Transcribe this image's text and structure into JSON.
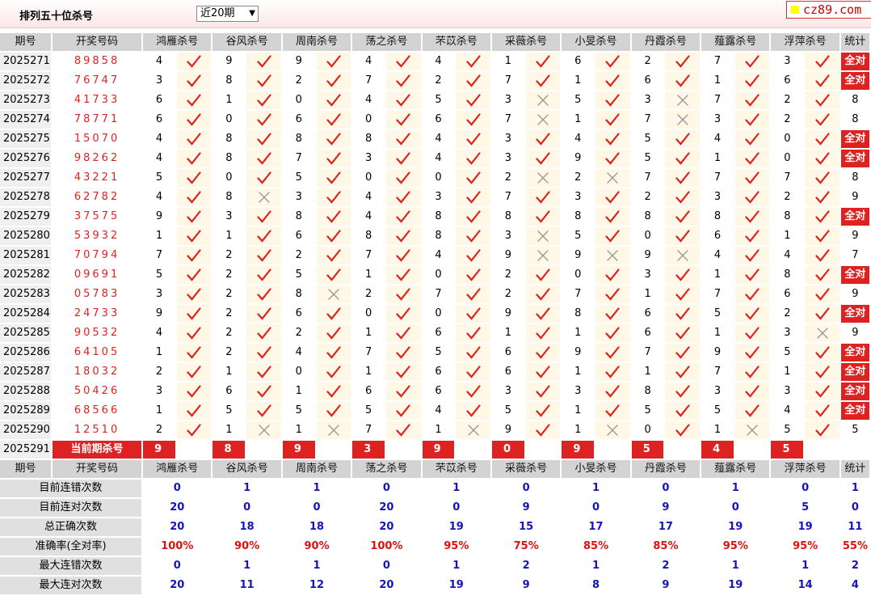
{
  "header": {
    "title": "排列五十位杀号",
    "period_select": "近20期",
    "logo": "cz89.com"
  },
  "table": {
    "columns": [
      "期号",
      "开奖号码",
      "鸿雁杀号",
      "谷风杀号",
      "周南杀号",
      "荡之杀号",
      "芣苡杀号",
      "采薇杀号",
      "小旻杀号",
      "丹霞杀号",
      "薤露杀号",
      "浮萍杀号",
      "统计"
    ],
    "rows": [
      {
        "issue": "2025271",
        "draw": "89858",
        "kills": [
          "4",
          "9",
          "9",
          "4",
          "4",
          "1",
          "6",
          "2",
          "7",
          "3"
        ],
        "results": [
          "v",
          "v",
          "v",
          "v",
          "v",
          "v",
          "v",
          "v",
          "v",
          "v"
        ],
        "stat": "全对"
      },
      {
        "issue": "2025272",
        "draw": "76747",
        "kills": [
          "3",
          "8",
          "2",
          "7",
          "2",
          "7",
          "1",
          "6",
          "1",
          "6"
        ],
        "results": [
          "v",
          "v",
          "v",
          "v",
          "v",
          "v",
          "v",
          "v",
          "v",
          "v"
        ],
        "stat": "全对"
      },
      {
        "issue": "2025273",
        "draw": "41733",
        "kills": [
          "6",
          "1",
          "0",
          "4",
          "5",
          "3",
          "5",
          "3",
          "7",
          "2"
        ],
        "results": [
          "v",
          "v",
          "v",
          "v",
          "v",
          "x",
          "v",
          "x",
          "v",
          "v"
        ],
        "stat": "8"
      },
      {
        "issue": "2025274",
        "draw": "78771",
        "kills": [
          "6",
          "0",
          "6",
          "0",
          "6",
          "7",
          "1",
          "7",
          "3",
          "2"
        ],
        "results": [
          "v",
          "v",
          "v",
          "v",
          "v",
          "x",
          "v",
          "x",
          "v",
          "v"
        ],
        "stat": "8"
      },
      {
        "issue": "2025275",
        "draw": "15070",
        "kills": [
          "4",
          "8",
          "8",
          "8",
          "4",
          "3",
          "4",
          "5",
          "4",
          "0"
        ],
        "results": [
          "v",
          "v",
          "v",
          "v",
          "v",
          "v",
          "v",
          "v",
          "v",
          "v"
        ],
        "stat": "全对"
      },
      {
        "issue": "2025276",
        "draw": "98262",
        "kills": [
          "4",
          "8",
          "7",
          "3",
          "4",
          "3",
          "9",
          "5",
          "1",
          "0"
        ],
        "results": [
          "v",
          "v",
          "v",
          "v",
          "v",
          "v",
          "v",
          "v",
          "v",
          "v"
        ],
        "stat": "全对"
      },
      {
        "issue": "2025277",
        "draw": "43221",
        "kills": [
          "5",
          "0",
          "5",
          "0",
          "0",
          "2",
          "2",
          "7",
          "7",
          "7"
        ],
        "results": [
          "v",
          "v",
          "v",
          "v",
          "v",
          "x",
          "x",
          "v",
          "v",
          "v"
        ],
        "stat": "8"
      },
      {
        "issue": "2025278",
        "draw": "62782",
        "kills": [
          "4",
          "8",
          "3",
          "4",
          "3",
          "7",
          "3",
          "2",
          "3",
          "2"
        ],
        "results": [
          "v",
          "x",
          "v",
          "v",
          "v",
          "v",
          "v",
          "v",
          "v",
          "v"
        ],
        "stat": "9"
      },
      {
        "issue": "2025279",
        "draw": "37575",
        "kills": [
          "9",
          "3",
          "8",
          "4",
          "8",
          "8",
          "8",
          "8",
          "8",
          "8"
        ],
        "results": [
          "v",
          "v",
          "v",
          "v",
          "v",
          "v",
          "v",
          "v",
          "v",
          "v"
        ],
        "stat": "全对"
      },
      {
        "issue": "2025280",
        "draw": "53932",
        "kills": [
          "1",
          "1",
          "6",
          "8",
          "8",
          "3",
          "5",
          "0",
          "6",
          "1"
        ],
        "results": [
          "v",
          "v",
          "v",
          "v",
          "v",
          "x",
          "v",
          "v",
          "v",
          "v"
        ],
        "stat": "9"
      },
      {
        "issue": "2025281",
        "draw": "70794",
        "kills": [
          "7",
          "2",
          "2",
          "7",
          "4",
          "9",
          "9",
          "9",
          "4",
          "4"
        ],
        "results": [
          "v",
          "v",
          "v",
          "v",
          "v",
          "x",
          "x",
          "x",
          "v",
          "v"
        ],
        "stat": "7"
      },
      {
        "issue": "2025282",
        "draw": "09691",
        "kills": [
          "5",
          "2",
          "5",
          "1",
          "0",
          "2",
          "0",
          "3",
          "1",
          "8"
        ],
        "results": [
          "v",
          "v",
          "v",
          "v",
          "v",
          "v",
          "v",
          "v",
          "v",
          "v"
        ],
        "stat": "全对"
      },
      {
        "issue": "2025283",
        "draw": "05783",
        "kills": [
          "3",
          "2",
          "8",
          "2",
          "7",
          "2",
          "7",
          "1",
          "7",
          "6"
        ],
        "results": [
          "v",
          "v",
          "x",
          "v",
          "v",
          "v",
          "v",
          "v",
          "v",
          "v"
        ],
        "stat": "9"
      },
      {
        "issue": "2025284",
        "draw": "24733",
        "kills": [
          "9",
          "2",
          "6",
          "0",
          "0",
          "9",
          "8",
          "6",
          "5",
          "2"
        ],
        "results": [
          "v",
          "v",
          "v",
          "v",
          "v",
          "v",
          "v",
          "v",
          "v",
          "v"
        ],
        "stat": "全对"
      },
      {
        "issue": "2025285",
        "draw": "90532",
        "kills": [
          "4",
          "2",
          "2",
          "1",
          "6",
          "1",
          "1",
          "6",
          "1",
          "3"
        ],
        "results": [
          "v",
          "v",
          "v",
          "v",
          "v",
          "v",
          "v",
          "v",
          "v",
          "x"
        ],
        "stat": "9"
      },
      {
        "issue": "2025286",
        "draw": "64105",
        "kills": [
          "1",
          "2",
          "4",
          "7",
          "5",
          "6",
          "9",
          "7",
          "9",
          "5"
        ],
        "results": [
          "v",
          "v",
          "v",
          "v",
          "v",
          "v",
          "v",
          "v",
          "v",
          "v"
        ],
        "stat": "全对"
      },
      {
        "issue": "2025287",
        "draw": "18032",
        "kills": [
          "2",
          "1",
          "0",
          "1",
          "6",
          "6",
          "1",
          "1",
          "7",
          "1"
        ],
        "results": [
          "v",
          "v",
          "v",
          "v",
          "v",
          "v",
          "v",
          "v",
          "v",
          "v"
        ],
        "stat": "全对"
      },
      {
        "issue": "2025288",
        "draw": "50426",
        "kills": [
          "3",
          "6",
          "1",
          "6",
          "6",
          "3",
          "3",
          "8",
          "3",
          "3"
        ],
        "results": [
          "v",
          "v",
          "v",
          "v",
          "v",
          "v",
          "v",
          "v",
          "v",
          "v"
        ],
        "stat": "全对"
      },
      {
        "issue": "2025289",
        "draw": "68566",
        "kills": [
          "1",
          "5",
          "5",
          "5",
          "4",
          "5",
          "1",
          "5",
          "5",
          "4"
        ],
        "results": [
          "v",
          "v",
          "v",
          "v",
          "v",
          "v",
          "v",
          "v",
          "v",
          "v"
        ],
        "stat": "全对"
      },
      {
        "issue": "2025290",
        "draw": "12510",
        "kills": [
          "2",
          "1",
          "1",
          "7",
          "1",
          "9",
          "1",
          "0",
          "1",
          "5"
        ],
        "results": [
          "v",
          "x",
          "x",
          "v",
          "x",
          "v",
          "x",
          "v",
          "x",
          "v"
        ],
        "stat": "5"
      }
    ],
    "current": {
      "issue": "2025291",
      "label": "当前期杀号",
      "kills": [
        "9",
        "8",
        "9",
        "3",
        "9",
        "0",
        "9",
        "5",
        "4",
        "5"
      ]
    },
    "summary": [
      {
        "label": "目前连错次数",
        "values": [
          "0",
          "1",
          "1",
          "0",
          "1",
          "0",
          "1",
          "0",
          "1",
          "0",
          "1"
        ],
        "color": "blue"
      },
      {
        "label": "目前连对次数",
        "values": [
          "20",
          "0",
          "0",
          "20",
          "0",
          "9",
          "0",
          "9",
          "0",
          "5",
          "0"
        ],
        "color": "blue"
      },
      {
        "label": "总正确次数",
        "values": [
          "20",
          "18",
          "18",
          "20",
          "19",
          "15",
          "17",
          "17",
          "19",
          "19",
          "11"
        ],
        "color": "blue"
      },
      {
        "label": "准确率(全对率)",
        "values": [
          "100%",
          "90%",
          "90%",
          "100%",
          "95%",
          "75%",
          "85%",
          "85%",
          "95%",
          "95%",
          "55%"
        ],
        "color": "red"
      },
      {
        "label": "最大连错次数",
        "values": [
          "0",
          "1",
          "1",
          "0",
          "1",
          "2",
          "1",
          "2",
          "1",
          "1",
          "2"
        ],
        "color": "blue"
      },
      {
        "label": "最大连对次数",
        "values": [
          "20",
          "11",
          "12",
          "20",
          "19",
          "9",
          "8",
          "9",
          "19",
          "14",
          "4"
        ],
        "color": "blue"
      }
    ]
  },
  "colors": {
    "accent": "#dd2222",
    "check": "#e02020",
    "cross": "#999999",
    "summary_blue": "#1515b8",
    "summary_red": "#e01010"
  },
  "icons": {
    "v": "check-icon",
    "x": "cross-icon"
  }
}
